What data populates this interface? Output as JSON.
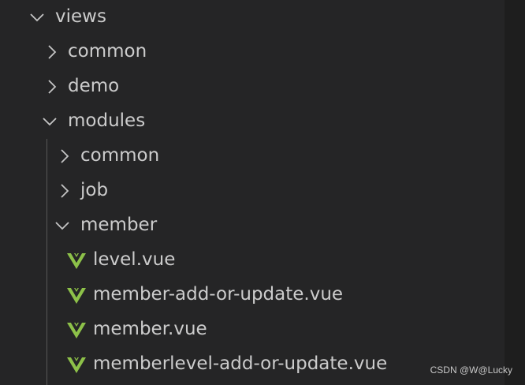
{
  "explorer": {
    "items": [
      {
        "label": "views",
        "kind": "folder",
        "expanded": true,
        "icon": "chevron-down-icon"
      },
      {
        "label": "common",
        "kind": "folder",
        "expanded": false,
        "icon": "chevron-right-icon"
      },
      {
        "label": "demo",
        "kind": "folder",
        "expanded": false,
        "icon": "chevron-right-icon"
      },
      {
        "label": "modules",
        "kind": "folder",
        "expanded": true,
        "icon": "chevron-down-icon"
      },
      {
        "label": "common",
        "kind": "folder",
        "expanded": false,
        "icon": "chevron-right-icon"
      },
      {
        "label": "job",
        "kind": "folder",
        "expanded": false,
        "icon": "chevron-right-icon"
      },
      {
        "label": "member",
        "kind": "folder",
        "expanded": true,
        "icon": "chevron-down-icon"
      },
      {
        "label": "level.vue",
        "kind": "file",
        "icon": "vue-file-icon"
      },
      {
        "label": "member-add-or-update.vue",
        "kind": "file",
        "icon": "vue-file-icon"
      },
      {
        "label": "member.vue",
        "kind": "file",
        "icon": "vue-file-icon"
      },
      {
        "label": "memberlevel-add-or-update.vue",
        "kind": "file",
        "icon": "vue-file-icon"
      }
    ]
  },
  "watermark": "CSDN @W@Lucky",
  "colors": {
    "background": "#252526",
    "text": "#cccccc",
    "chevron": "#c5c5c5",
    "vue_green": "#8dc149",
    "guide": "#585858"
  }
}
